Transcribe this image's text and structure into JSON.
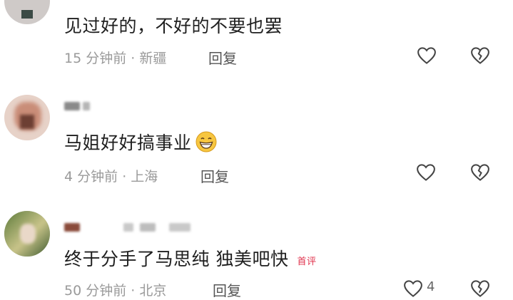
{
  "comments": [
    {
      "text": "见过好的，不好的不要也罢",
      "time": "15 分钟前",
      "location": "新疆",
      "reply_label": "回复"
    },
    {
      "text": "马姐好好搞事业",
      "time": "4 分钟前",
      "location": "上海",
      "reply_label": "回复",
      "emoji": "grinning-face-emoji"
    },
    {
      "text": "终于分手了马思纯 独美吧快",
      "badge": "首评",
      "time": "50 分钟前",
      "location": "北京",
      "reply_label": "回复",
      "like_count": "4"
    }
  ],
  "separator": "·",
  "icons": {
    "like": "heart-icon",
    "dislike": "broken-heart-icon"
  },
  "colors": {
    "badge": "#e0334d",
    "meta": "#9a9a9a",
    "text": "#1f1f1f"
  }
}
